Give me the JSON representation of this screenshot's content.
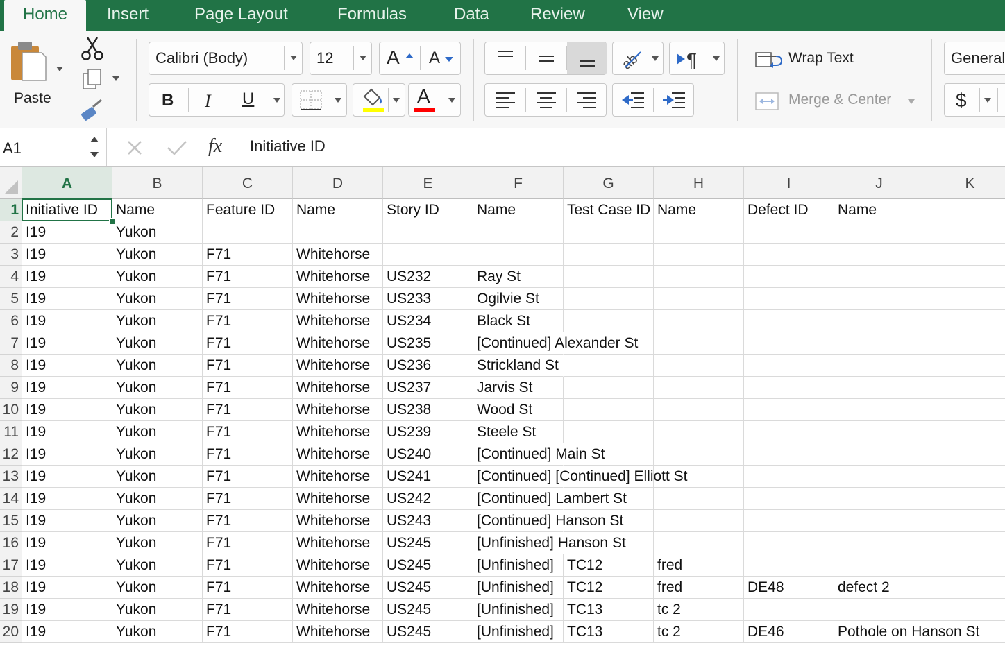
{
  "tabs": [
    {
      "label": "Home",
      "active": true
    },
    {
      "label": "Insert",
      "active": false
    },
    {
      "label": "Page Layout",
      "active": false
    },
    {
      "label": "Formulas",
      "active": false
    },
    {
      "label": "Data",
      "active": false
    },
    {
      "label": "Review",
      "active": false
    },
    {
      "label": "View",
      "active": false
    }
  ],
  "ribbon": {
    "paste_label": "Paste",
    "font_name": "Calibri (Body)",
    "font_size": "12",
    "grow_font": "A",
    "shrink_font": "A",
    "bold": "B",
    "italic": "I",
    "underline": "U",
    "font_color_glyph": "A",
    "wrap_text": "Wrap Text",
    "merge_center": "Merge & Center",
    "number_format": "General",
    "currency_glyph": "$",
    "fill_color": "#ffff00",
    "font_color": "#ff0000",
    "brand_color": "#217346"
  },
  "formula_bar": {
    "name_box": "A1",
    "fx": "fx",
    "content": "Initiative ID"
  },
  "grid": {
    "columns": [
      "A",
      "B",
      "C",
      "D",
      "E",
      "F",
      "G",
      "H",
      "I",
      "J",
      "K"
    ],
    "selected_column": "A",
    "selected_row": "1",
    "rows": [
      {
        "n": "1",
        "cells": [
          "Initiative ID",
          "Name",
          "Feature ID",
          "Name",
          "Story ID",
          "Name",
          "Test Case ID",
          "Name",
          "Defect ID",
          "Name",
          ""
        ]
      },
      {
        "n": "2",
        "cells": [
          "I19",
          "Yukon",
          "",
          "",
          "",
          "",
          "",
          "",
          "",
          "",
          ""
        ]
      },
      {
        "n": "3",
        "cells": [
          "I19",
          "Yukon",
          "F71",
          "Whitehorse",
          "",
          "",
          "",
          "",
          "",
          "",
          ""
        ]
      },
      {
        "n": "4",
        "cells": [
          "I19",
          "Yukon",
          "F71",
          "Whitehorse",
          "US232",
          "Ray St",
          "",
          "",
          "",
          "",
          ""
        ]
      },
      {
        "n": "5",
        "cells": [
          "I19",
          "Yukon",
          "F71",
          "Whitehorse",
          "US233",
          "Ogilvie St",
          "",
          "",
          "",
          "",
          ""
        ]
      },
      {
        "n": "6",
        "cells": [
          "I19",
          "Yukon",
          "F71",
          "Whitehorse",
          "US234",
          "Black St",
          "",
          "",
          "",
          "",
          ""
        ]
      },
      {
        "n": "7",
        "cells": [
          "I19",
          "Yukon",
          "F71",
          "Whitehorse",
          "US235",
          "[Continued] Alexander St",
          "",
          "",
          "",
          "",
          ""
        ]
      },
      {
        "n": "8",
        "cells": [
          "I19",
          "Yukon",
          "F71",
          "Whitehorse",
          "US236",
          "Strickland St",
          "",
          "",
          "",
          "",
          ""
        ]
      },
      {
        "n": "9",
        "cells": [
          "I19",
          "Yukon",
          "F71",
          "Whitehorse",
          "US237",
          "Jarvis St",
          "",
          "",
          "",
          "",
          ""
        ]
      },
      {
        "n": "10",
        "cells": [
          "I19",
          "Yukon",
          "F71",
          "Whitehorse",
          "US238",
          "Wood St",
          "",
          "",
          "",
          "",
          ""
        ]
      },
      {
        "n": "11",
        "cells": [
          "I19",
          "Yukon",
          "F71",
          "Whitehorse",
          "US239",
          "Steele St",
          "",
          "",
          "",
          "",
          ""
        ]
      },
      {
        "n": "12",
        "cells": [
          "I19",
          "Yukon",
          "F71",
          "Whitehorse",
          "US240",
          "[Continued] Main St",
          "",
          "",
          "",
          "",
          ""
        ]
      },
      {
        "n": "13",
        "cells": [
          "I19",
          "Yukon",
          "F71",
          "Whitehorse",
          "US241",
          "[Continued] [Continued] Elliott St",
          "",
          "",
          "",
          "",
          ""
        ]
      },
      {
        "n": "14",
        "cells": [
          "I19",
          "Yukon",
          "F71",
          "Whitehorse",
          "US242",
          "[Continued] Lambert St",
          "",
          "",
          "",
          "",
          ""
        ]
      },
      {
        "n": "15",
        "cells": [
          "I19",
          "Yukon",
          "F71",
          "Whitehorse",
          "US243",
          "[Continued] Hanson St",
          "",
          "",
          "",
          "",
          ""
        ]
      },
      {
        "n": "16",
        "cells": [
          "I19",
          "Yukon",
          "F71",
          "Whitehorse",
          "US245",
          "[Unfinished] Hanson St",
          "",
          "",
          "",
          "",
          ""
        ]
      },
      {
        "n": "17",
        "cells": [
          "I19",
          "Yukon",
          "F71",
          "Whitehorse",
          "US245",
          "[Unfinished]",
          "TC12",
          "fred",
          "",
          "",
          ""
        ]
      },
      {
        "n": "18",
        "cells": [
          "I19",
          "Yukon",
          "F71",
          "Whitehorse",
          "US245",
          "[Unfinished]",
          "TC12",
          "fred",
          "DE48",
          "defect 2",
          ""
        ]
      },
      {
        "n": "19",
        "cells": [
          "I19",
          "Yukon",
          "F71",
          "Whitehorse",
          "US245",
          "[Unfinished]",
          "TC13",
          "tc 2",
          "",
          "",
          ""
        ]
      },
      {
        "n": "20",
        "cells": [
          "I19",
          "Yukon",
          "F71",
          "Whitehorse",
          "US245",
          "[Unfinished]",
          "TC13",
          "tc 2",
          "DE46",
          "Pothole on Hanson St",
          ""
        ]
      }
    ]
  }
}
